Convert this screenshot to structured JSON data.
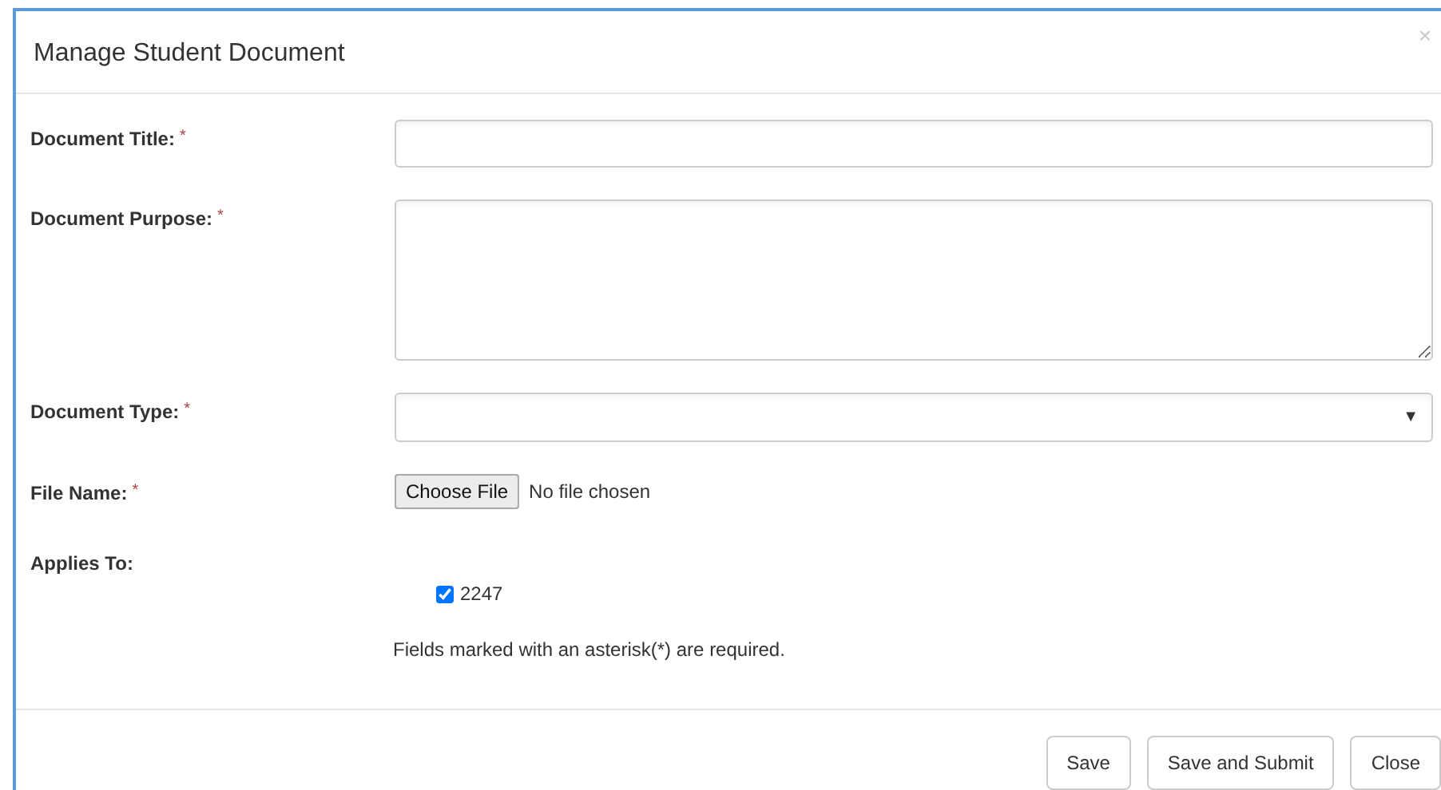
{
  "dialog": {
    "title": "Manage Student Document",
    "close": "×"
  },
  "fields": [
    {
      "kind": "text",
      "label": "Document Title:",
      "required_mark": "*"
    },
    {
      "kind": "textarea",
      "label": "Document Purpose:",
      "required_mark": "*"
    },
    {
      "kind": "select",
      "label": "Document Type:",
      "required_mark": "*",
      "caret": "▼"
    },
    {
      "kind": "file",
      "label": "File Name:",
      "required_mark": "*",
      "button": "Choose File",
      "status": "No file chosen"
    },
    {
      "kind": "checkboxes",
      "label": "Applies To:",
      "options": [
        {
          "label": "2247",
          "checked": true
        }
      ]
    }
  ],
  "note": "Fields marked with an asterisk(*) are required.",
  "buttons": [
    "Save",
    "Save and Submit",
    "Close"
  ]
}
